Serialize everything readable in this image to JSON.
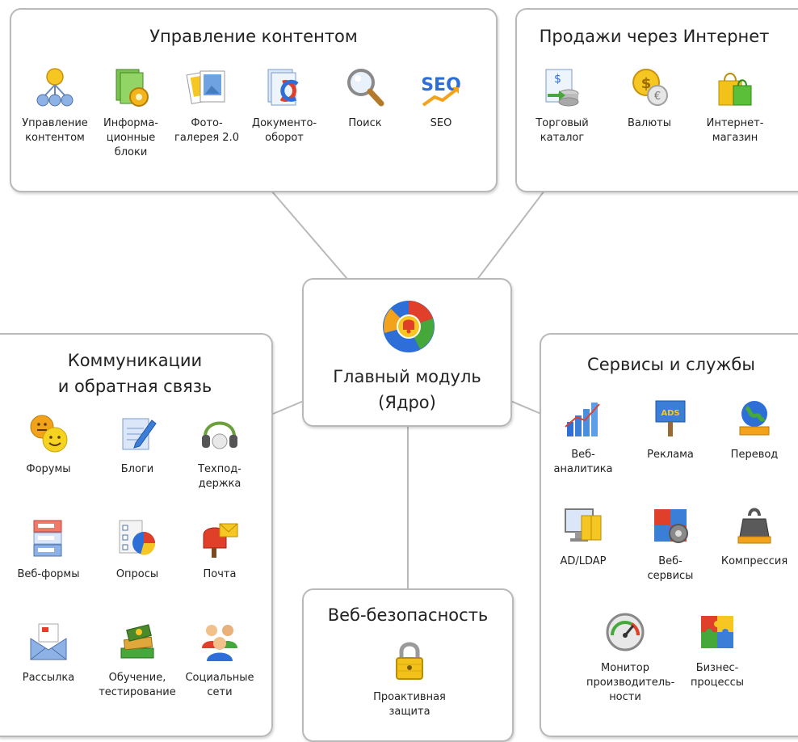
{
  "content_management": {
    "title": "Управление контентом",
    "items": [
      {
        "label": "Управление\nконтентом",
        "icon": "hierarchy-icon"
      },
      {
        "label": "Информа-\nционные\nблоки",
        "icon": "info-blocks-gear-icon"
      },
      {
        "label": "Фото-\nгалерея 2.0",
        "icon": "photo-gallery-icon"
      },
      {
        "label": "Документо-\nоборот",
        "icon": "document-flow-icon"
      },
      {
        "label": "Поиск",
        "icon": "magnifier-icon"
      },
      {
        "label": "SEO",
        "icon": "seo-icon"
      }
    ]
  },
  "internet_sales": {
    "title": "Продажи через Интернет",
    "items": [
      {
        "label": "Торговый\nкаталог",
        "icon": "trade-catalog-icon"
      },
      {
        "label": "Валюты",
        "icon": "currency-coins-icon"
      },
      {
        "label": "Интернет-\nмагазин",
        "icon": "shopping-bags-icon"
      }
    ]
  },
  "core": {
    "title": "Главный модуль\n(Ядро)",
    "icon": "core-logo-icon"
  },
  "communications": {
    "title": "Коммуникации\nи обратная связь",
    "items": [
      {
        "label": "Форумы",
        "icon": "forum-smileys-icon"
      },
      {
        "label": "Блоги",
        "icon": "blog-pencil-icon"
      },
      {
        "label": "Техпод-\nдержка",
        "icon": "headset-icon"
      },
      {
        "label": "Веб-формы",
        "icon": "web-forms-icon"
      },
      {
        "label": "Опросы",
        "icon": "poll-chart-icon"
      },
      {
        "label": "Почта",
        "icon": "mailbox-icon"
      },
      {
        "label": "Рассылка",
        "icon": "envelope-icon"
      },
      {
        "label": "Обучение,\nтестирование",
        "icon": "books-icon"
      },
      {
        "label": "Социальные\nсети",
        "icon": "people-icon"
      }
    ]
  },
  "services": {
    "title": "Сервисы и службы",
    "items": [
      {
        "label": "Веб-\nаналитика",
        "icon": "analytics-bars-icon"
      },
      {
        "label": "Реклама",
        "icon": "ads-sign-icon"
      },
      {
        "label": "Перевод",
        "icon": "globe-book-icon"
      },
      {
        "label": "AD/LDAP",
        "icon": "monitor-book-icon"
      },
      {
        "label": "Веб-\nсервисы",
        "icon": "web-services-gear-icon"
      },
      {
        "label": "Компрессия",
        "icon": "weight-icon"
      },
      {
        "label": "Монитор\nпроизводитель-\nности",
        "icon": "gauge-icon"
      },
      {
        "label": "Бизнес-\nпроцессы",
        "icon": "puzzle-icon"
      }
    ]
  },
  "security": {
    "title": "Веб-безопасность",
    "items": [
      {
        "label": "Проактивная\nзащита",
        "icon": "padlock-icon"
      }
    ]
  }
}
